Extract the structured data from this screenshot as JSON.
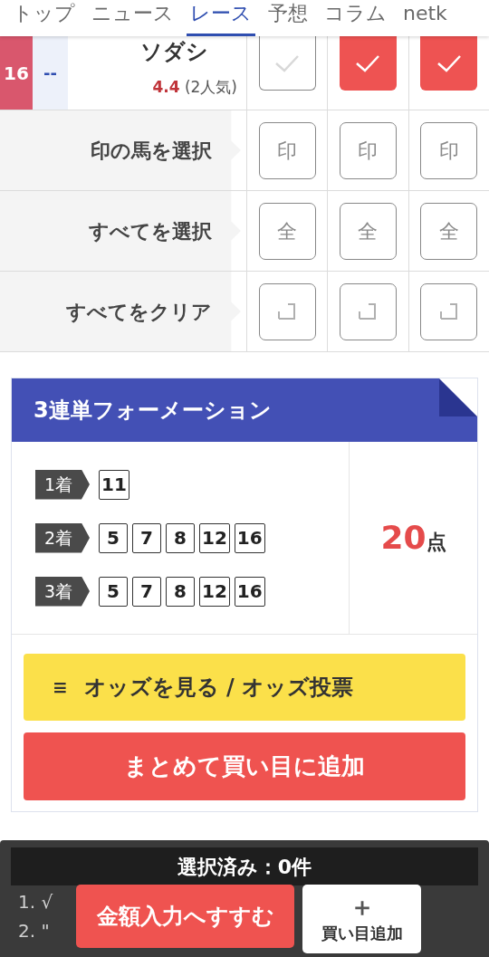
{
  "tabs": [
    {
      "label": "トップ",
      "selected": false
    },
    {
      "label": "ニュース",
      "selected": false
    },
    {
      "label": "レース",
      "selected": true
    },
    {
      "label": "予想",
      "selected": false
    },
    {
      "label": "コラム",
      "selected": false
    },
    {
      "label": "netk",
      "selected": false
    }
  ],
  "horse": {
    "number": "16",
    "mark": "--",
    "name": "ソダシ",
    "odds": "4.4",
    "popularity": "(2人気)",
    "checks": [
      false,
      true,
      true
    ]
  },
  "actions": [
    {
      "label": "印の馬を選択",
      "kind": "mark",
      "glyphs": [
        "印",
        "印",
        "印"
      ]
    },
    {
      "label": "すべてを選択",
      "kind": "all",
      "glyphs": [
        "全",
        "全",
        "全"
      ]
    },
    {
      "label": "すべてをクリア",
      "kind": "clear"
    }
  ],
  "formation": {
    "title": "3連単フォーメーション",
    "places": [
      {
        "label": "1着",
        "numbers": [
          "11"
        ]
      },
      {
        "label": "2着",
        "numbers": [
          "5",
          "7",
          "8",
          "12",
          "16"
        ]
      },
      {
        "label": "3着",
        "numbers": [
          "5",
          "7",
          "8",
          "12",
          "16"
        ]
      }
    ],
    "points": "20",
    "points_unit": "点",
    "odds_button": {
      "icon": "≡",
      "label": "オッズを見る / オッズ投票"
    },
    "add_button": "まとめて買い目に追加"
  },
  "behind_text": [
    "1. √",
    "2. \""
  ],
  "bottom_bar": {
    "selected_count": "選択済み：0件",
    "proceed_button": "金額入力へすすむ",
    "add_button": {
      "icon": "＋",
      "label": "買い目追加"
    }
  }
}
